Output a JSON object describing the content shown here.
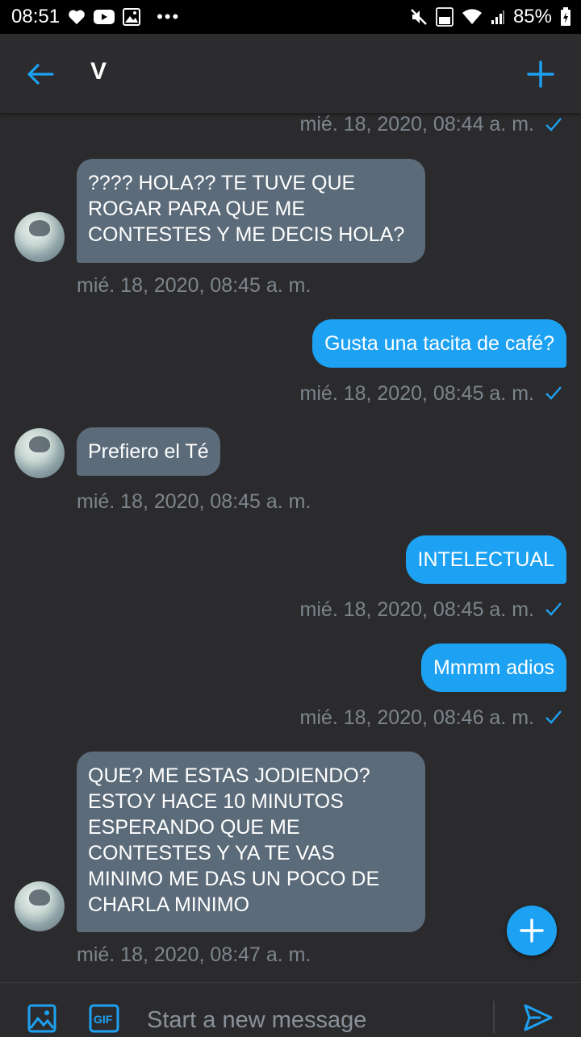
{
  "status_bar": {
    "time": "08:51",
    "battery": "85%"
  },
  "header": {
    "title": "V"
  },
  "messages": [
    {
      "direction": "out",
      "timestamp": "mié. 18, 2020, 08:44 a. m.",
      "status": "sent"
    },
    {
      "direction": "in",
      "text": "???? HOLA?? TE TUVE QUE\nROGAR PARA QUE ME\nCONTESTES Y ME DECIS HOLA?",
      "timestamp": "mié. 18, 2020, 08:45 a. m."
    },
    {
      "direction": "out",
      "text": "Gusta una tacita de café?",
      "timestamp": "mié. 18, 2020, 08:45 a. m.",
      "status": "sent"
    },
    {
      "direction": "in",
      "text": "Prefiero el Té",
      "timestamp": "mié. 18, 2020, 08:45 a. m."
    },
    {
      "direction": "out",
      "text": "INTELECTUAL",
      "timestamp": "mié. 18, 2020, 08:45 a. m.",
      "status": "sent"
    },
    {
      "direction": "out",
      "text": "Mmmm adios",
      "timestamp": "mié. 18, 2020, 08:46 a. m.",
      "status": "sent"
    },
    {
      "direction": "in",
      "text": "QUE? ME ESTAS JODIENDO?\nESTOY HACE 10 MINUTOS\nESPERANDO QUE ME\nCONTESTES Y YA TE VAS\nMINIMO ME DAS UN POCO DE\nCHARLA MINIMO",
      "timestamp": "mié. 18, 2020, 08:47 a. m."
    }
  ],
  "composer": {
    "placeholder": "Start a new message",
    "gif_label": "GIF"
  },
  "colors": {
    "accent": "#1da1f2",
    "incoming_bubble": "#5c6b7a",
    "background": "#2b2b2d",
    "timestamp": "#7d858c"
  },
  "icons": [
    "heart-icon",
    "youtube-icon",
    "gallery-icon",
    "more-dots-icon",
    "mute-icon",
    "volte-icon",
    "wifi-icon",
    "signal-icon",
    "battery-icon",
    "back-arrow-icon",
    "plus-icon",
    "check-icon",
    "image-icon",
    "gif-icon",
    "send-icon"
  ]
}
